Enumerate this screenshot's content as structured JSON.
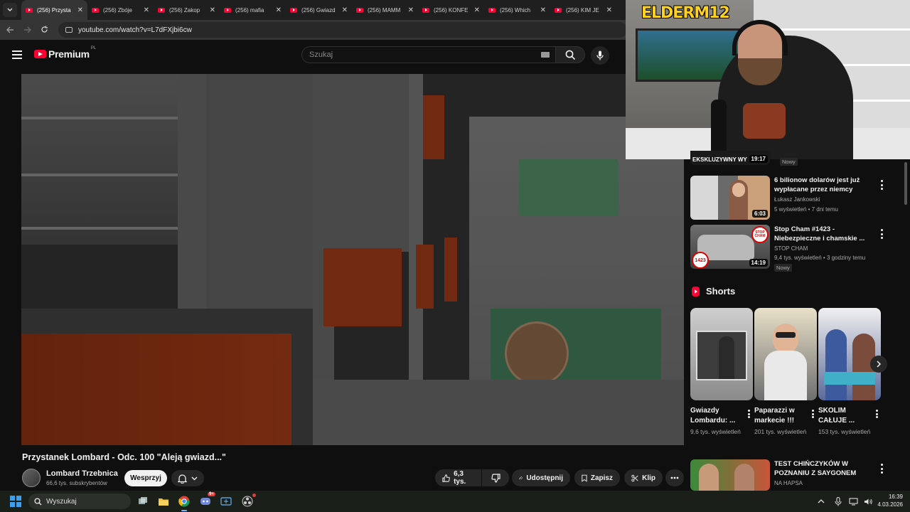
{
  "browser": {
    "tabs": [
      {
        "label": "(256) Przysta",
        "active": true
      },
      {
        "label": "(256) Zbóje",
        "active": false
      },
      {
        "label": "(256) Zakop",
        "active": false
      },
      {
        "label": "(256) mafia",
        "active": false
      },
      {
        "label": "(256) Gwiazd",
        "active": false
      },
      {
        "label": "(256) MAMM",
        "active": false
      },
      {
        "label": "(256) KONFE",
        "active": false
      },
      {
        "label": "(256) Which",
        "active": false
      },
      {
        "label": "(256) KIM JE",
        "active": false
      }
    ],
    "url": "youtube.com/watch?v=L7dFXjbi6cw"
  },
  "youtube": {
    "brand": "Premium",
    "region": "PL",
    "search_placeholder": "Szukaj",
    "video": {
      "title": "Przystanek Lombard - Odc. 100 \"Aleją gwiazd...\"",
      "channel": "Lombard Trzebnica",
      "subscribers": "66,6 tys. subskrybentów",
      "support_label": "Wesprzyj",
      "likes": "6,3 tys.",
      "share_label": "Udostępnij",
      "save_label": "Zapisz",
      "clip_label": "Klip"
    }
  },
  "overlay": {
    "streamer_logo": "ELDER",
    "streamer_logo_num": "M12"
  },
  "sidebar": {
    "top_partial": {
      "title": "EKSKLUZYWNY WY",
      "duration": "19:17",
      "badge": "Nowy"
    },
    "videos": [
      {
        "title": "6 bilionow dolarów jest już wypłacane przez niemcy",
        "channel": "Łukasz Jankowski",
        "meta": "5 wyświetleń • 7 dni temu",
        "duration": "6:03",
        "badge": ""
      },
      {
        "title": "Stop Cham #1423 - Niebezpieczne i chamskie ...",
        "channel": "STOP CHAM",
        "meta": "9,4 tys. wyświetleń • 3 godziny temu",
        "duration": "14:19",
        "badge": "Nowy",
        "thumb_badge": "1423"
      }
    ],
    "shorts_label": "Shorts",
    "shorts": [
      {
        "title": "Gwiazdy Lombardu: ...",
        "views": "9,6 tys. wyświetleń"
      },
      {
        "title": "Paparazzi w markecie !!!",
        "views": "201 tys. wyświetleń"
      },
      {
        "title": "SKOLIM CAŁUJE ...",
        "views": "153 tys. wyświetleń"
      }
    ],
    "bottom_video": {
      "title": "TEST CHIŃCZYKÓW W POZNANIU Z SAYGONEM",
      "channel": "NA HAPSA"
    }
  },
  "taskbar": {
    "search_label": "Wyszukaj",
    "time": "16:39",
    "date": "4.03.2026",
    "discord_badge": "9+"
  }
}
